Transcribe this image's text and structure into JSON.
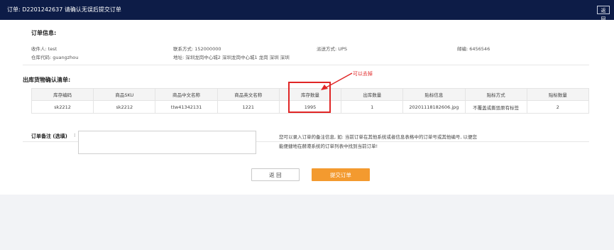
{
  "header": {
    "title": "订单: D2201242637 请确认无误后提交订单",
    "back_label": "返 回"
  },
  "order_info": {
    "section_title": "订单信息:",
    "receiver": "收件人: test",
    "phone": "联系方式: 152000000",
    "shipping": "派送方式: UPS",
    "postcode": "邮编: 6456546",
    "warehouse": "仓库代码: guangzhou",
    "address": "地址: 深圳龙岗中心城2 深圳龙岗中心城1 龙岗 深圳 深圳"
  },
  "outbound": {
    "section_title": "出库货物确认清单:",
    "columns": [
      "库存编码",
      "商品SKU",
      "商品中文名称",
      "商品英文名称",
      "库存数量",
      "出库数量",
      "贴标信息",
      "贴标方式",
      "贴标数量"
    ],
    "rows": [
      [
        "sk2212",
        "sk2212",
        "ttw41342131",
        "1221",
        "1995",
        "1",
        "20201118182606.jpg",
        "不覆盖或撕毁原有标签",
        "2"
      ]
    ]
  },
  "annotation": {
    "text": "可以去掉"
  },
  "remark": {
    "label": "订单备注 (选填)",
    "colon": ":",
    "value": "",
    "help_line1": "您可以录入订单的备注信息, 如: 当前订单在其他系统或者信息表格中的订单号或其他编号, 以便您",
    "help_line2": "能便捷地在赫港系统的订单列表中找到当前订单!"
  },
  "buttons": {
    "back": "返 回",
    "submit": "提交订单"
  },
  "colors": {
    "header_bg": "#0d1c47",
    "accent": "#f39a2f",
    "highlight": "#e02626"
  }
}
